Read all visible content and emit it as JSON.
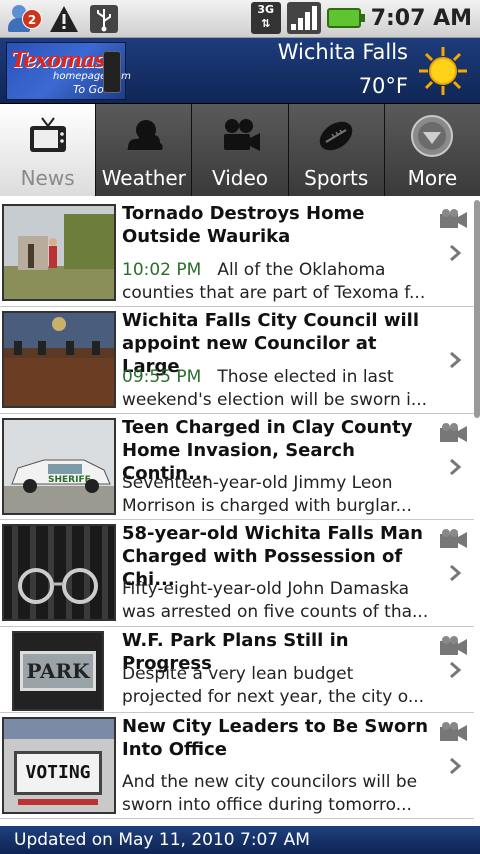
{
  "statusbar": {
    "notification_count": "2",
    "network": "3G",
    "time": "7:07 AM"
  },
  "header": {
    "logo": {
      "brand": "Texomas",
      "sub": "homepage.com",
      "sub2": "To Go"
    },
    "city": "Wichita Falls",
    "temperature": "70°F",
    "weather_icon": "sun-icon"
  },
  "tabs": [
    {
      "label": "News",
      "icon": "tv-icon",
      "active": true
    },
    {
      "label": "Weather",
      "icon": "cloud-sun-icon",
      "active": false
    },
    {
      "label": "Video",
      "icon": "video-camera-icon",
      "active": false
    },
    {
      "label": "Sports",
      "icon": "football-icon",
      "active": false
    },
    {
      "label": "More",
      "icon": "chevron-down-circle-icon",
      "active": false
    }
  ],
  "articles": [
    {
      "title": "Tornado Destroys Home Outside Waurika",
      "time": "10:02 PM",
      "summary": "All of the Oklahoma counties that are part of Texoma f...",
      "thumb": "tornado-damage-photo"
    },
    {
      "title": "Wichita Falls City Council will appoint new Councilor at Large",
      "time": "09:55 PM",
      "summary": "Those elected in last weekend's election will be sworn i...",
      "thumb": "city-council-photo"
    },
    {
      "title": "Teen Charged in Clay County Home Invasion, Search Contin...",
      "time": "",
      "summary": "Seventeen-year-old Jimmy Leon Morrison is charged with burglar...",
      "thumb": "sheriff-car-photo"
    },
    {
      "title": "58-year-old Wichita Falls Man Charged with Possession of Chi...",
      "time": "",
      "summary": "Fifty-eight-year-old John Damaska was arrested on five counts of tha...",
      "thumb": "handcuffs-photo"
    },
    {
      "title": "W.F. Park Plans Still in Progress",
      "time": "",
      "summary": "Despite a very lean budget projected for next year, the city o...",
      "thumb": "park-sign-photo"
    },
    {
      "title": "New City Leaders to Be Sworn Into Office",
      "time": "",
      "summary": "And the new city councilors will be sworn into office during tomorro...",
      "thumb": "voting-sign-photo"
    }
  ],
  "thumb_text": {
    "park": "PARK",
    "voting": "VOTING"
  },
  "footer": {
    "updated": "Updated on May 11, 2010 7:07 AM"
  }
}
